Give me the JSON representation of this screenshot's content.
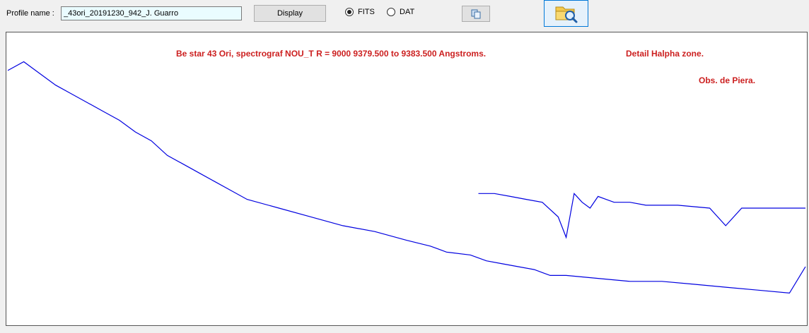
{
  "toolbar": {
    "profile_label": "Profile name :",
    "profile_value": "_43ori_20191230_942_J. Guarro",
    "display_label": "Display",
    "format_options": [
      {
        "label": "FITS",
        "selected": true
      },
      {
        "label": "DAT",
        "selected": false
      }
    ],
    "copy_icon": "copy-icon",
    "open_icon": "folder-search-icon"
  },
  "annotations": {
    "title": "Be star 43 Ori,  spectrograf NOU_T  R = 9000    9379.500 to 9383.500 Angstroms.",
    "detail": "Detail Halpha zone.",
    "observatory": "Obs. de  Piera."
  },
  "colors": {
    "spectrum": "#0000e0",
    "annotation": "#cc1f1f",
    "input_bg": "#eafcff"
  },
  "chart_data": {
    "type": "line",
    "xlabel": "",
    "ylabel": "",
    "grid": false,
    "axes_visible": false,
    "series": [
      {
        "x": [
          0,
          0.02,
          0.04,
          0.06,
          0.08,
          0.1,
          0.12,
          0.14,
          0.16,
          0.18,
          0.2,
          0.22,
          0.24,
          0.26,
          0.28,
          0.3,
          0.34,
          0.38,
          0.42,
          0.46,
          0.5,
          0.53,
          0.54,
          0.55,
          0.58,
          0.59,
          0.6,
          0.62,
          0.64,
          0.66,
          0.67,
          0.68,
          0.7,
          0.74,
          0.78,
          0.82,
          0.86,
          0.9,
          0.94,
          0.98,
          1.0
        ],
        "y": [
          0.87,
          0.9,
          0.86,
          0.82,
          0.79,
          0.76,
          0.73,
          0.7,
          0.66,
          0.63,
          0.58,
          0.55,
          0.52,
          0.49,
          0.46,
          0.43,
          0.4,
          0.37,
          0.34,
          0.32,
          0.29,
          0.27,
          0.26,
          0.25,
          0.24,
          0.23,
          0.22,
          0.21,
          0.2,
          0.19,
          0.18,
          0.17,
          0.17,
          0.16,
          0.15,
          0.15,
          0.14,
          0.13,
          0.12,
          0.11,
          0.2
        ]
      },
      {
        "x": [
          0.59,
          0.61,
          0.63,
          0.65,
          0.67,
          0.69,
          0.7,
          0.71,
          0.72,
          0.73,
          0.74,
          0.75,
          0.76,
          0.78,
          0.8,
          0.84,
          0.88,
          0.9,
          0.92,
          0.96,
          1.0
        ],
        "y": [
          0.45,
          0.45,
          0.44,
          0.43,
          0.42,
          0.37,
          0.3,
          0.45,
          0.42,
          0.4,
          0.44,
          0.43,
          0.42,
          0.42,
          0.41,
          0.41,
          0.4,
          0.34,
          0.4,
          0.4,
          0.4
        ]
      }
    ]
  }
}
